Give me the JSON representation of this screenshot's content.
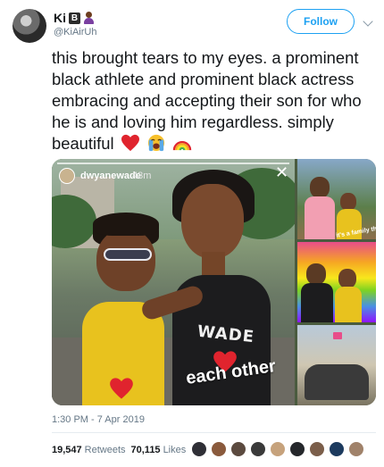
{
  "header": {
    "display_name": "Ki",
    "name_emoji_letter": "B",
    "handle": "@KiAirUh",
    "follow_label": "Follow"
  },
  "tweet": {
    "text": "this brought tears to my eyes. a prominent black athlete and prominent black actress embracing and accepting their son for who he is and loving him regardless. simply beautiful",
    "trailing_emojis": [
      "red-heart",
      "loudly-crying-face",
      "rainbow"
    ]
  },
  "media": {
    "story_user": "dwyanewade",
    "story_time": "43m",
    "close_glyph": "✕",
    "caption": "each other",
    "wade_shirt_text": "WADE",
    "thumb2_label": "it's a family thing",
    "colors": {
      "shirt_yellow": "#e8c21e",
      "heart_red": "#e0242e"
    }
  },
  "footer": {
    "timestamp": "1:30 PM - 7 Apr 2019",
    "retweets_count": "19,547",
    "retweets_label": "Retweets",
    "likes_count": "70,115",
    "likes_label": "Likes",
    "liker_colors": [
      "#2f2f36",
      "#8a5a3c",
      "#5b4a3f",
      "#3a3a3a",
      "#c6a27c",
      "#25272b",
      "#7b5e4a",
      "#1c3a5e",
      "#a0826a"
    ]
  },
  "colors": {
    "accent": "#1da1f2",
    "text_primary": "#14171a",
    "text_secondary": "#657786"
  }
}
